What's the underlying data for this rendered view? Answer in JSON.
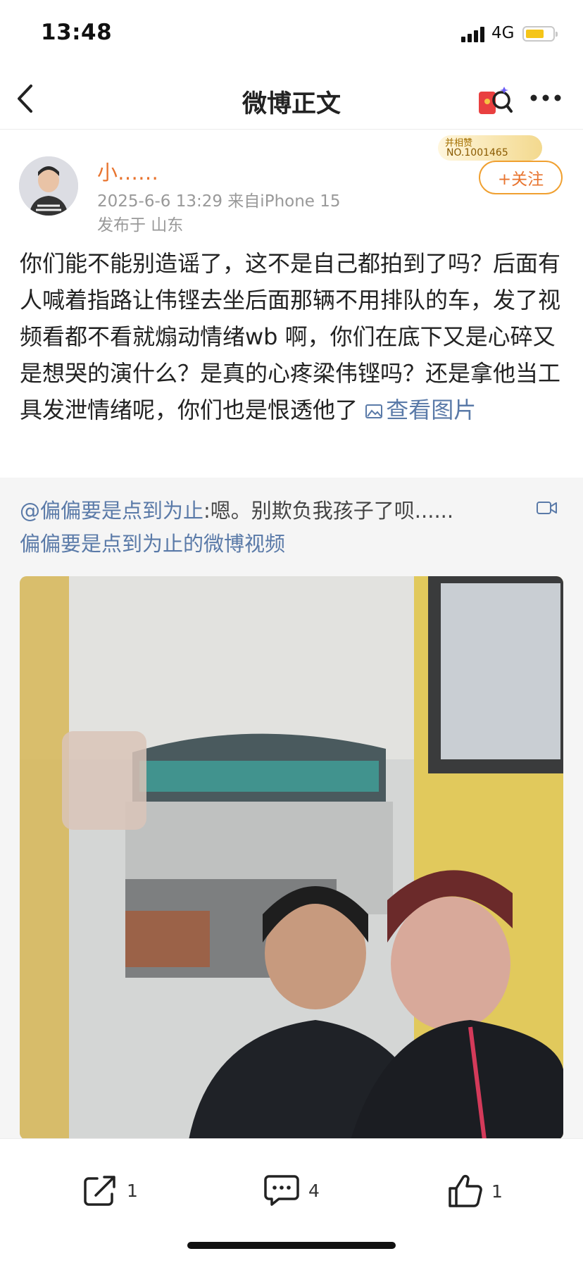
{
  "status_bar": {
    "time": "13:48",
    "network": "4G",
    "battery_level": 0.7
  },
  "nav": {
    "title": "微博正文"
  },
  "post": {
    "author": {
      "name": "小……",
      "badge_line1": "并相赞",
      "badge_line2": "NO.1001465"
    },
    "meta": "2025-6-6 13:29  来自iPhone 15",
    "location": "发布于 山东",
    "follow_label": "+关注",
    "text": "你们能不能别造谣了，这不是自己都拍到了吗？后面有人喊着指路让伟铿去坐后面那辆不用排队的车，发了视频看都不看就煽动情绪wb 啊，你们在底下又是心碎又是想哭的演什么？是真的心疼梁伟铿吗？还是拿他当工具发泄情绪呢，你们也是恨透他了",
    "view_pics": "查看图片"
  },
  "repost": {
    "mention": "@偏偏要是点到为止",
    "text": ":嗯。别欺负我孩子了呗......",
    "video_label": "偏偏要是点到为止的微博视频"
  },
  "toolbar": {
    "repost_count": "1",
    "comment_count": "4",
    "like_count": "1"
  }
}
